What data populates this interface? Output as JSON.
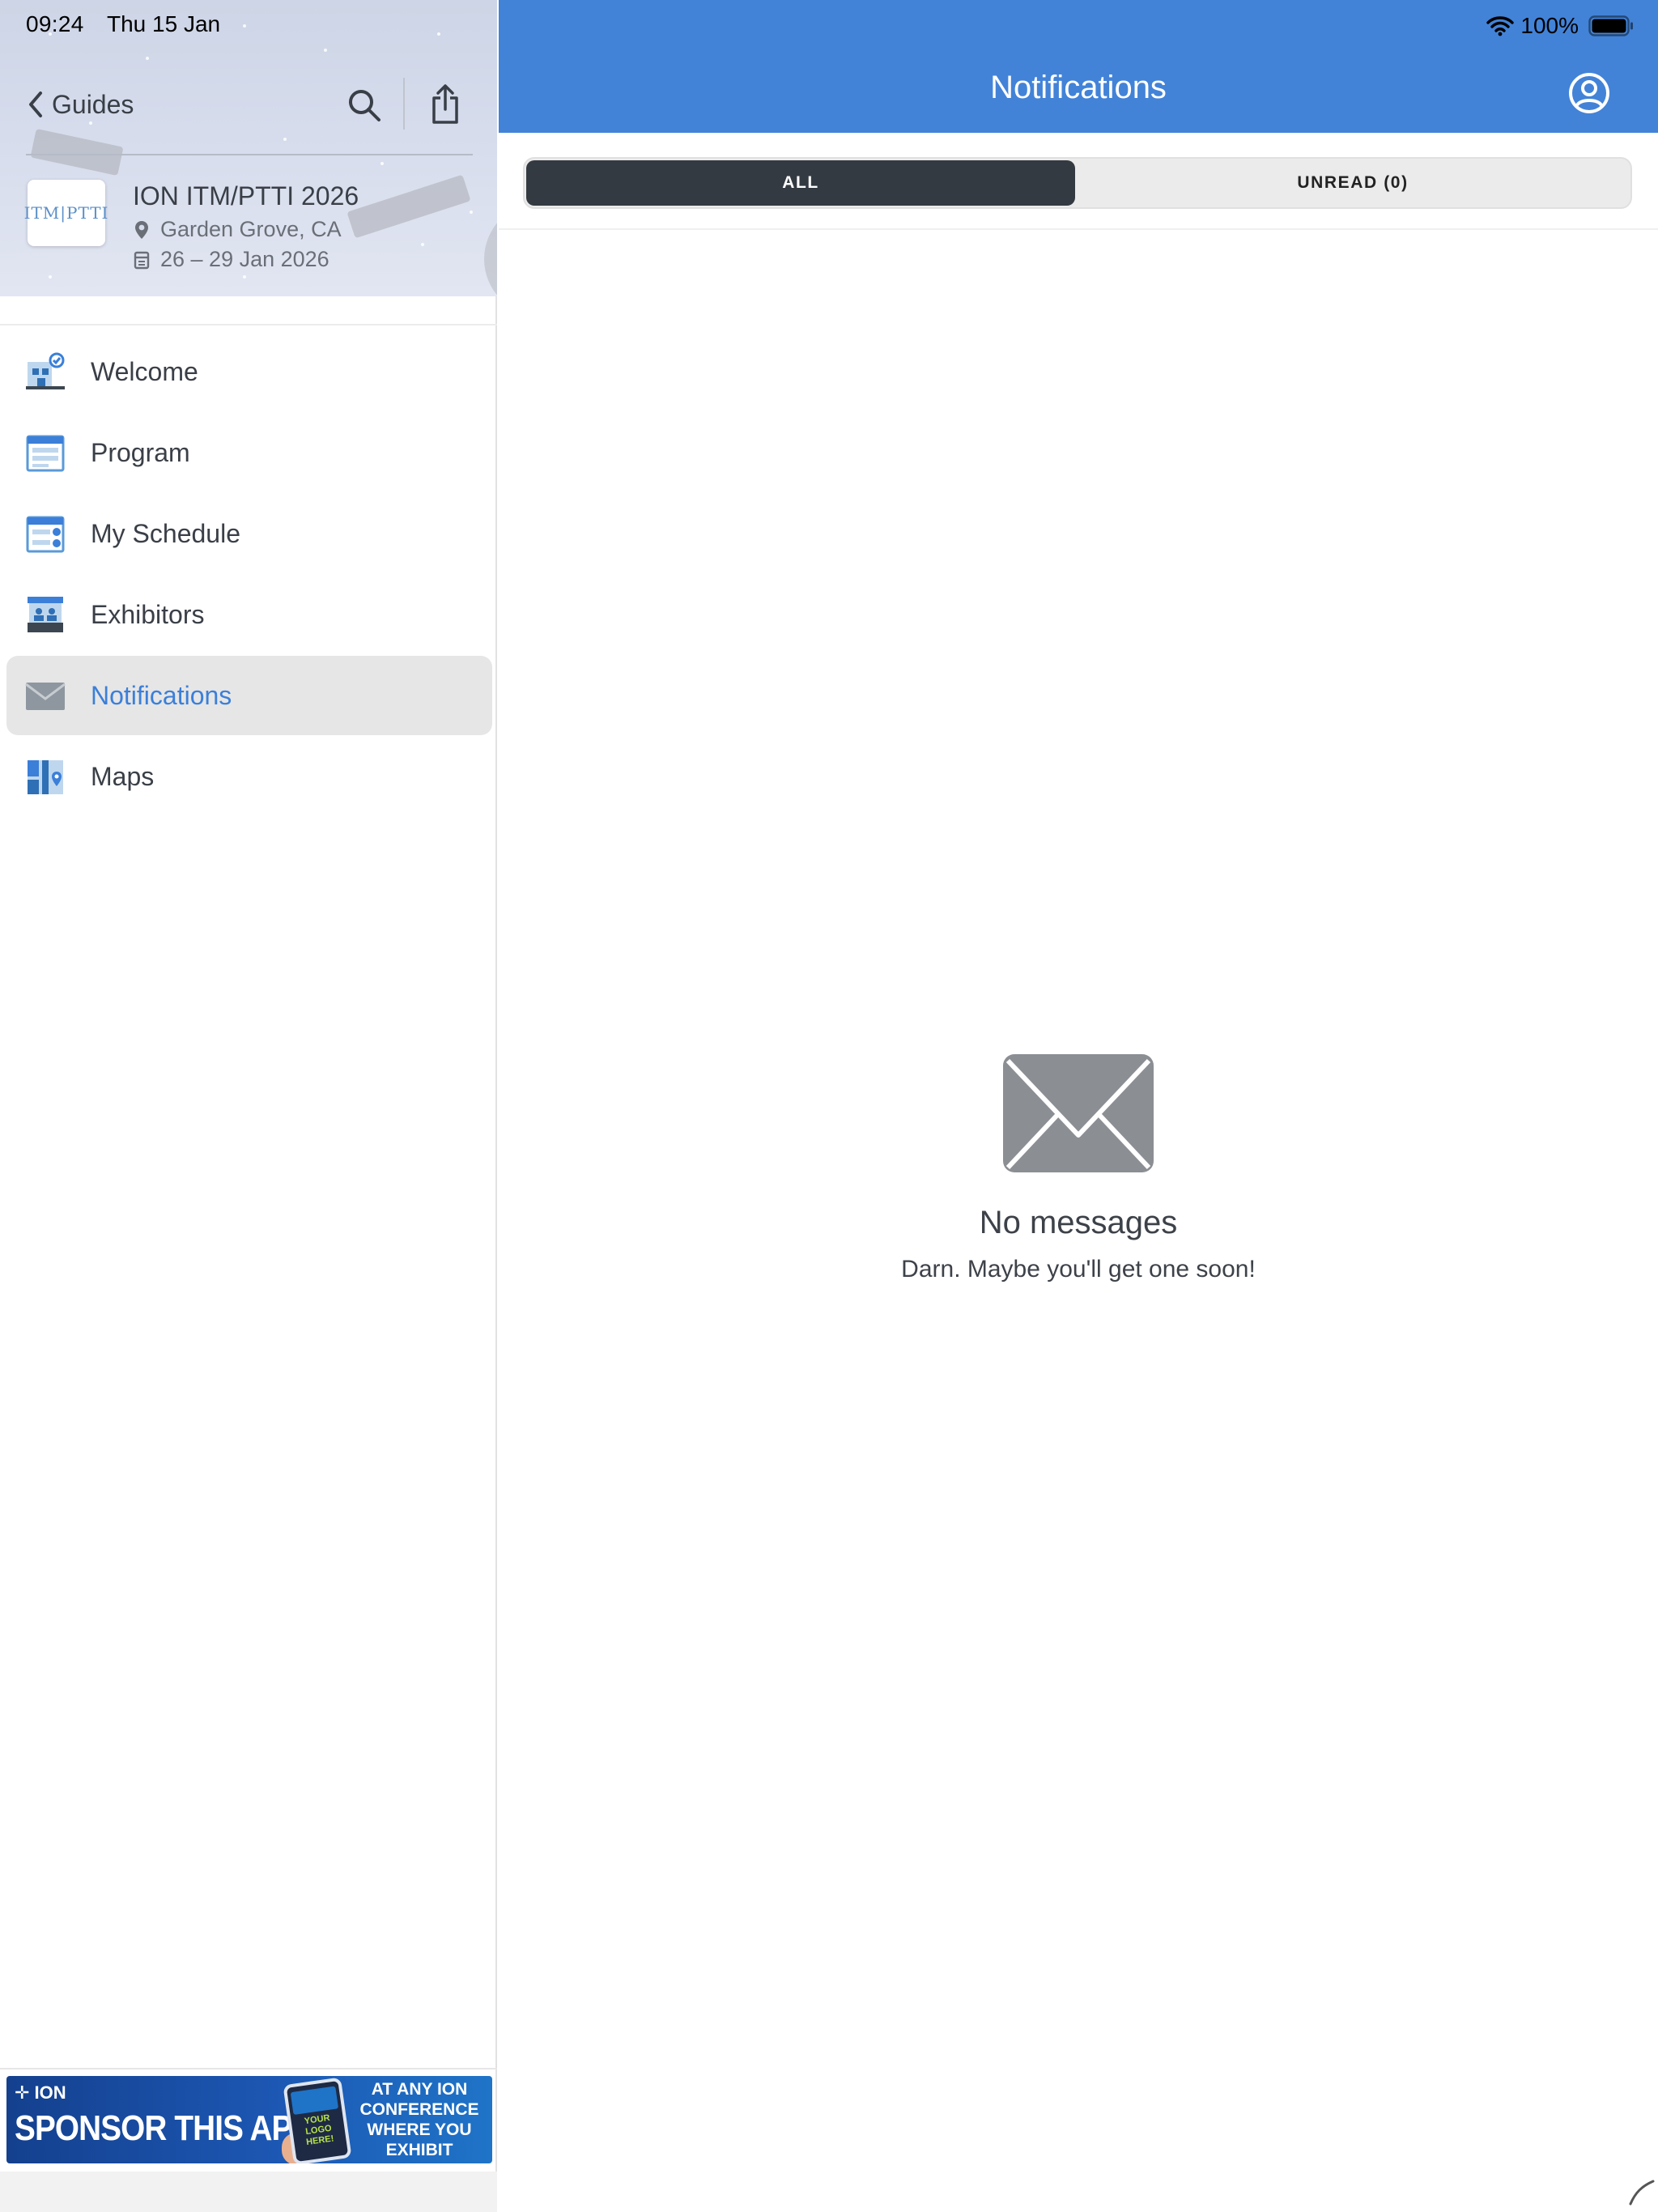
{
  "status_bar": {
    "time": "09:24",
    "date": "Thu 15 Jan",
    "battery": "100%"
  },
  "sidebar": {
    "back_label": "Guides",
    "event": {
      "logo_text": "ITM|PTTI",
      "title": "ION ITM/PTTI 2026",
      "location": "Garden Grove, CA",
      "dates": "26 – 29 Jan 2026"
    },
    "items": [
      {
        "label": "Welcome",
        "icon": "welcome-icon"
      },
      {
        "label": "Program",
        "icon": "calendar-icon"
      },
      {
        "label": "My Schedule",
        "icon": "schedule-check-icon"
      },
      {
        "label": "Exhibitors",
        "icon": "exhibitor-booth-icon"
      },
      {
        "label": "Notifications",
        "icon": "envelope-icon",
        "active": true
      },
      {
        "label": "Maps",
        "icon": "map-pin-icon"
      }
    ],
    "banner": {
      "brand": "ION",
      "headline": "SPONSOR THIS APP",
      "phone_text": "YOUR LOGO HERE!",
      "right_text": "AT ANY ION CONFERENCE WHERE YOU EXHIBIT"
    }
  },
  "main": {
    "title": "Notifications",
    "tabs": [
      {
        "label": "ALL",
        "selected": true
      },
      {
        "label": "UNREAD (0)",
        "selected": false
      }
    ],
    "empty_state": {
      "title": "No messages",
      "subtitle": "Darn. Maybe you'll get one soon!"
    }
  },
  "colors": {
    "topbar": "#4283d8",
    "active_nav_text": "#3b7fd9",
    "selected_tab_bg": "#343a41",
    "empty_icon": "#8b8e93"
  }
}
